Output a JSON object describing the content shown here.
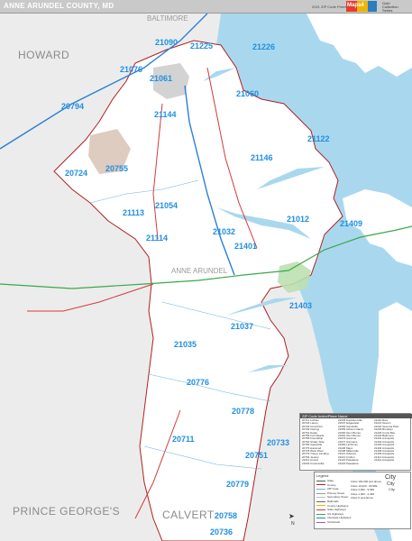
{
  "header": {
    "title": "ANNE ARUNDEL COUNTY, MD",
    "subtitle": "2021 ZIP Code Premium Edition",
    "logo_text": "Maps4",
    "extra": [
      "Gold",
      "Collection",
      "Series"
    ]
  },
  "colors": {
    "water": "#a9d8ee",
    "land": "#ffffff",
    "outside": "#ececec",
    "zip_label": "#1f8fe0",
    "zip_boundary": "#6fb3e0",
    "urban": "#c8c8c8",
    "park": "#cfe6c7",
    "interstate": "#2a7fd6",
    "us_highway": "#3aa84a",
    "state_highway": "#d33a3a",
    "county_boundary": "#b02020"
  },
  "county_labels": [
    {
      "id": "howard",
      "text": "HOWARD"
    },
    {
      "id": "prince-georges",
      "text": "PRINCE GEORGE'S"
    },
    {
      "id": "calvert",
      "text": "CALVERT"
    },
    {
      "id": "anne-arundel",
      "text": "ANNE ARUNDEL"
    },
    {
      "id": "baltimore",
      "text": "BALTIMORE"
    }
  ],
  "zip_labels": [
    {
      "id": "21090",
      "text": "21090"
    },
    {
      "id": "21225",
      "text": "21225"
    },
    {
      "id": "21226",
      "text": "21226"
    },
    {
      "id": "21076",
      "text": "21076"
    },
    {
      "id": "21061",
      "text": "21061"
    },
    {
      "id": "21060",
      "text": "21060"
    },
    {
      "id": "20794",
      "text": "20794"
    },
    {
      "id": "21144",
      "text": "21144"
    },
    {
      "id": "21122",
      "text": "21122"
    },
    {
      "id": "21146",
      "text": "21146"
    },
    {
      "id": "20724",
      "text": "20724"
    },
    {
      "id": "20755",
      "text": "20755"
    },
    {
      "id": "21054",
      "text": "21054"
    },
    {
      "id": "21113",
      "text": "21113"
    },
    {
      "id": "21012",
      "text": "21012"
    },
    {
      "id": "21409",
      "text": "21409"
    },
    {
      "id": "21032",
      "text": "21032"
    },
    {
      "id": "21114",
      "text": "21114"
    },
    {
      "id": "21401",
      "text": "21401"
    },
    {
      "id": "21403",
      "text": "21403"
    },
    {
      "id": "21037",
      "text": "21037"
    },
    {
      "id": "21035",
      "text": "21035"
    },
    {
      "id": "20776",
      "text": "20776"
    },
    {
      "id": "20778",
      "text": "20778"
    },
    {
      "id": "20711",
      "text": "20711"
    },
    {
      "id": "20733",
      "text": "20733"
    },
    {
      "id": "20751",
      "text": "20751"
    },
    {
      "id": "20779",
      "text": "20779"
    },
    {
      "id": "20758",
      "text": "20758"
    },
    {
      "id": "20736",
      "text": "20736"
    }
  ],
  "legend": {
    "title": "Legend",
    "items": [
      {
        "label": "State",
        "color": "#555555"
      },
      {
        "label": "County",
        "color": "#b02020"
      },
      {
        "label": "ZIP Code",
        "color": "#6fb3e0"
      },
      {
        "label": "Primary Street",
        "color": "#999999"
      },
      {
        "label": "Secondary Street",
        "color": "#bbbbbb"
      },
      {
        "label": "Railroads",
        "color": "#666666"
      },
      {
        "label": "County Highways",
        "color": "#f0b400"
      },
      {
        "label": "State Highways",
        "color": "#d33a3a"
      },
      {
        "label": "US Highways",
        "color": "#3aa84a"
      },
      {
        "label": "Interstate Highways",
        "color": "#2a7fd6"
      },
      {
        "label": "Toll Roads",
        "color": "#8c5fbf"
      }
    ],
    "city_samples": [
      "City",
      "City",
      "City"
    ],
    "city_classes": [
      "Cities 100,000 and above",
      "Cities 10,000 - 99,999",
      "Cities 2,500 - 9,999",
      "Cities 1,000 - 2,499",
      "Cities 0 and Above"
    ]
  },
  "zip_index": {
    "title": "ZIP Code Index/Place Name",
    "columns": [
      [
        "20711 Lothian",
        "20724 Laurel",
        "20733 Churchton",
        "20736 Owings",
        "20751 Deale",
        "20755 Fort Meade",
        "20758 Friendship",
        "20764 Shady Side",
        "20765 Galesville",
        "20776 Harwood",
        "20778 West River",
        "20779 Tracys Landing",
        "20794 Jessup",
        "21012 Arnold",
        "21032 Crownsville"
      ],
      [
        "21035 Davidsonville",
        "21037 Edgewater",
        "21054 Gambrills",
        "21056 Gibson Island",
        "21060 Glen Burnie",
        "21061 Glen Burnie",
        "21076 Hanover",
        "21077 Harmans",
        "21090 Linthicum",
        "21106 Mayo",
        "21108 Millersville",
        "21113 Odenton",
        "21114 Crofton",
        "21122 Pasadena",
        "21123 Pasadena"
      ],
      [
        "21140 Riva",
        "21144 Severn",
        "21146 Severna Park",
        "21225 Brooklyn",
        "21226 Curtis Bay",
        "21240 Baltimore",
        "21401 Annapolis",
        "21402 Annapolis",
        "21403 Annapolis",
        "21404 Annapolis",
        "21405 Annapolis",
        "21409 Annapolis",
        "21411 Annapolis",
        "21412 Annapolis"
      ]
    ]
  },
  "compass": "N"
}
